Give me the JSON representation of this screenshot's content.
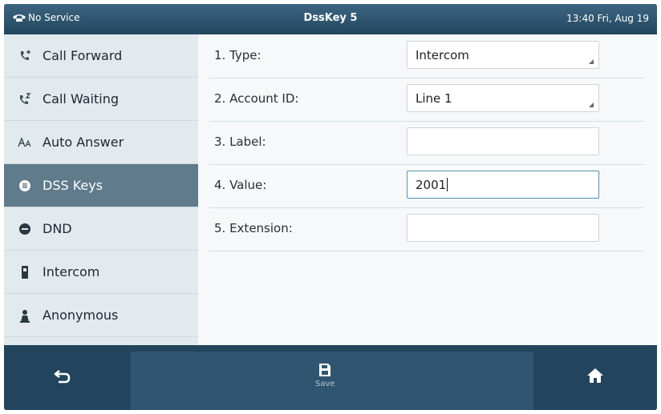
{
  "status": {
    "network_text": "No Service",
    "title": "DssKey 5",
    "datetime": "13:40 Fri, Aug 19",
    "phone_icon": "phone-icon"
  },
  "sidebar": {
    "items": [
      {
        "label": "Call Forward",
        "icon": "call-forward-icon",
        "active": false
      },
      {
        "label": "Call Waiting",
        "icon": "call-waiting-icon",
        "active": false
      },
      {
        "label": "Auto Answer",
        "icon": "auto-answer-icon",
        "active": false
      },
      {
        "label": "DSS Keys",
        "icon": "dss-keys-icon",
        "active": true
      },
      {
        "label": "DND",
        "icon": "dnd-icon",
        "active": false
      },
      {
        "label": "Intercom",
        "icon": "intercom-icon",
        "active": false
      },
      {
        "label": "Anonymous",
        "icon": "anonymous-icon",
        "active": false
      }
    ]
  },
  "form": {
    "type_label": "1. Type:",
    "type_value": "Intercom",
    "account_label": "2. Account ID:",
    "account_value": "Line 1",
    "label_label": "3. Label:",
    "label_value": "",
    "value_label": "4. Value:",
    "value_value": "2001",
    "extension_label": "5. Extension:",
    "extension_value": ""
  },
  "softkeys": {
    "back_icon": "back-icon",
    "save_label": "Save",
    "save_icon": "save-icon",
    "home_icon": "home-icon"
  },
  "colors": {
    "active_item": "#5f7b8c",
    "softkey_bar": "#22455d",
    "status_bar": "#2c5069"
  }
}
